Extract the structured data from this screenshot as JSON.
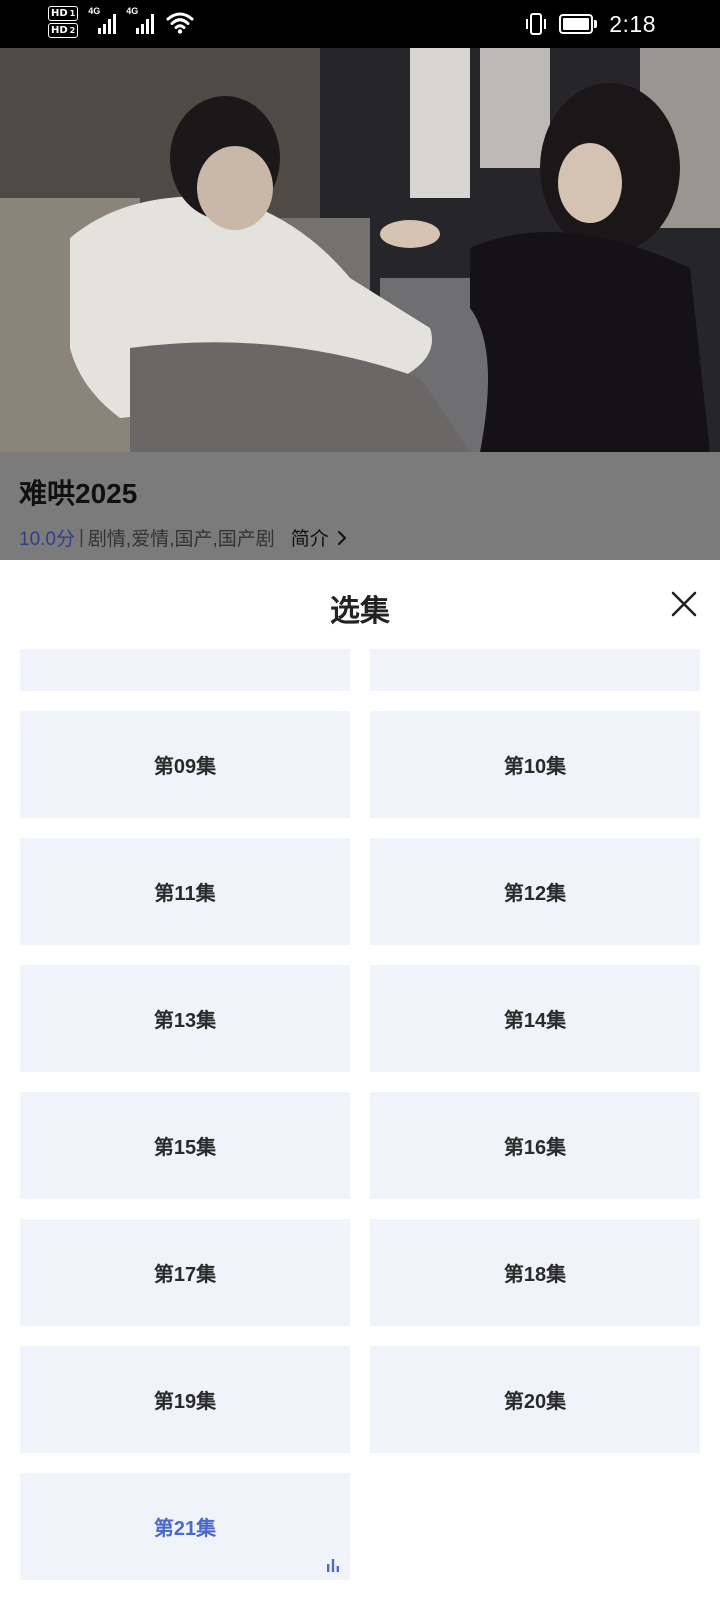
{
  "status_bar": {
    "hd1": "HD",
    "hd1_sub": "1",
    "hd2": "HD",
    "hd2_sub": "2",
    "signal1_label": "4G",
    "signal2_label": "4G",
    "time": "2:18",
    "battery_level": 1.0
  },
  "show": {
    "title": "难哄2025",
    "score": "10.0分",
    "separator": "|",
    "genres": "剧情,爱情,国产,国产剧",
    "intro_label": "简介"
  },
  "episode_sheet": {
    "title": "选集",
    "episodes": [
      {
        "label": ""
      },
      {
        "label": ""
      },
      {
        "label": "第09集"
      },
      {
        "label": "第10集"
      },
      {
        "label": "第11集"
      },
      {
        "label": "第12集"
      },
      {
        "label": "第13集"
      },
      {
        "label": "第14集"
      },
      {
        "label": "第15集"
      },
      {
        "label": "第16集"
      },
      {
        "label": "第17集"
      },
      {
        "label": "第18集"
      },
      {
        "label": "第19集"
      },
      {
        "label": "第20集"
      },
      {
        "label": "第21集",
        "playing": true
      }
    ],
    "active_color": "#4a69c8",
    "tile_color": "#f0f3fa"
  }
}
